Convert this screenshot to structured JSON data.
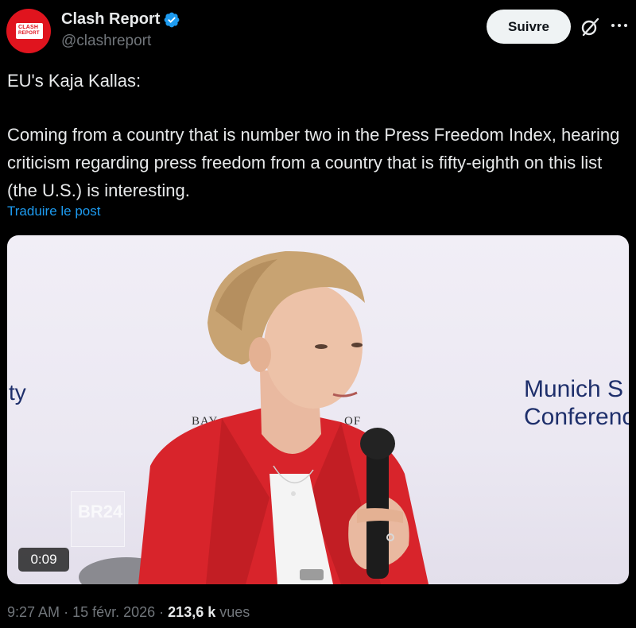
{
  "header": {
    "avatar": {
      "line1": "CLASH",
      "line2": "REPORT",
      "brand_color": "#e0141e"
    },
    "display_name": "Clash Report",
    "verified_icon": "verified-badge-icon",
    "handle": "@clashreport",
    "follow_label": "Suivre",
    "grok_icon": "grok-icon",
    "more_icon": "more-horizontal-icon"
  },
  "post": {
    "text_line1": "EU's Kaja Kallas:",
    "text_body": "Coming from a country that is number two in the Press Freedom Index, hearing criticism regarding press freedom from a country that is fifty-eighth on this list (the U.S.) is interesting.",
    "translate_label": "Traduire le post",
    "link_color": "#1d9bf0"
  },
  "media": {
    "backdrop_left": "ty",
    "backdrop_brand_left": "BAY",
    "backdrop_brand_right": "OF",
    "backdrop_right_line1": "Munich S",
    "backdrop_right_line2": "Conferenc",
    "watermark": "BR24",
    "duration": "0:09"
  },
  "meta": {
    "time": "9:27 AM",
    "date": "15 févr. 2026",
    "views_count": "213,6 k",
    "views_label": "vues"
  }
}
